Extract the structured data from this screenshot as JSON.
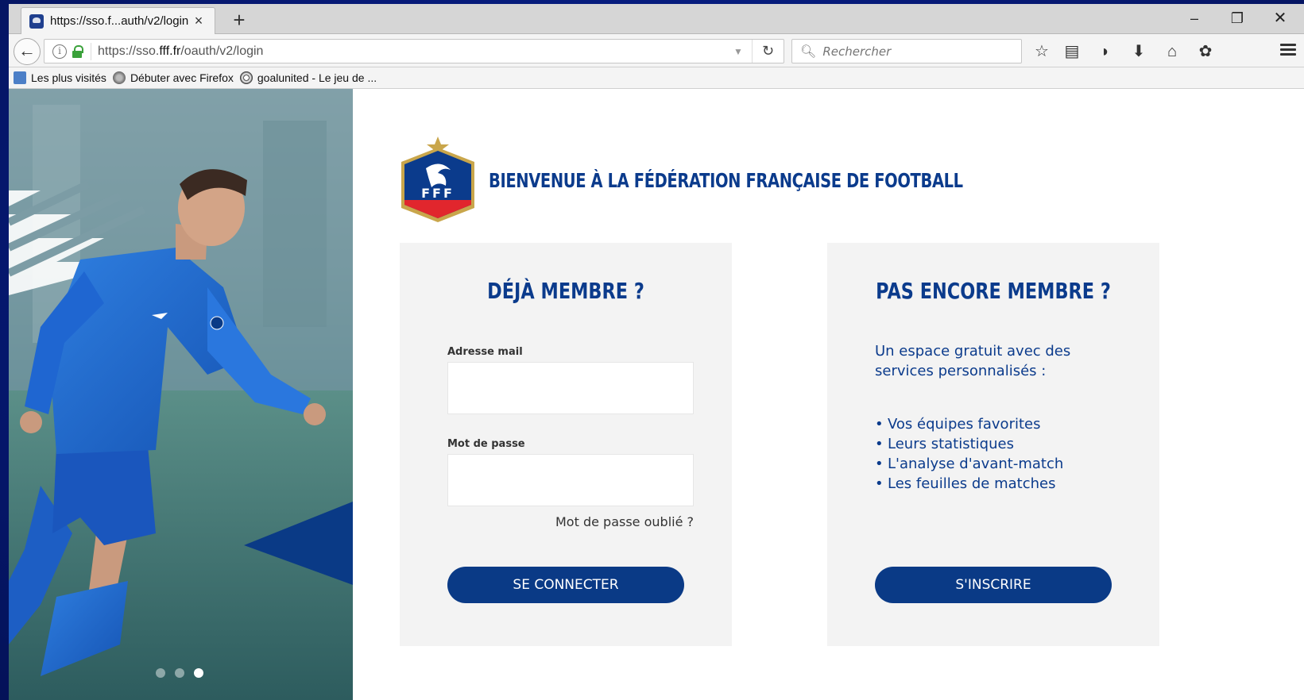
{
  "browser": {
    "tab_title": "https://sso.f...auth/v2/login",
    "tab_close": "×",
    "new_tab": "+",
    "window_minimize": "–",
    "window_restore": "❐",
    "window_close": "✕",
    "back": "←",
    "url_info": "i",
    "url_prefix": "https://sso.",
    "url_domain": "fff.fr",
    "url_path": "/oauth/v2/login",
    "url_dropdown": "▼",
    "reload": "↻",
    "search_placeholder": "Rechercher",
    "bookmarks": [
      {
        "label": "Les plus visités"
      },
      {
        "label": "Débuter avec Firefox"
      },
      {
        "label": "goalunited - Le jeu de ..."
      }
    ],
    "toolbar_icons": {
      "bookmark_star": "☆",
      "library": "▤",
      "pocket": "◗",
      "download": "⬇",
      "home": "⌂",
      "extension": "✿"
    }
  },
  "brand": {
    "title": "BIENVENUE À LA FÉDÉRATION FRANÇAISE DE FOOTBALL",
    "crest_text": "FFF",
    "colors": {
      "primary": "#0b3b8c",
      "button": "#0a3a86",
      "accent_red": "#e1262d",
      "gold": "#c9a64b"
    }
  },
  "login": {
    "heading": "DÉJÀ MEMBRE ?",
    "email_label": "Adresse mail",
    "email_value": "",
    "password_label": "Mot de passe",
    "password_value": "",
    "forgot_label": "Mot de passe oublié ?",
    "submit_label": "SE CONNECTER"
  },
  "signup": {
    "heading": "PAS ENCORE MEMBRE ?",
    "intro": "Un espace gratuit avec des services personnalisés :",
    "benefits": [
      "Vos équipes favorites",
      "Leurs statistiques",
      "L'analyse d'avant-match",
      "Les feuilles de matches"
    ],
    "submit_label": "S'INSCRIRE"
  },
  "carousel": {
    "dot_count": 3,
    "active_index": 2
  }
}
